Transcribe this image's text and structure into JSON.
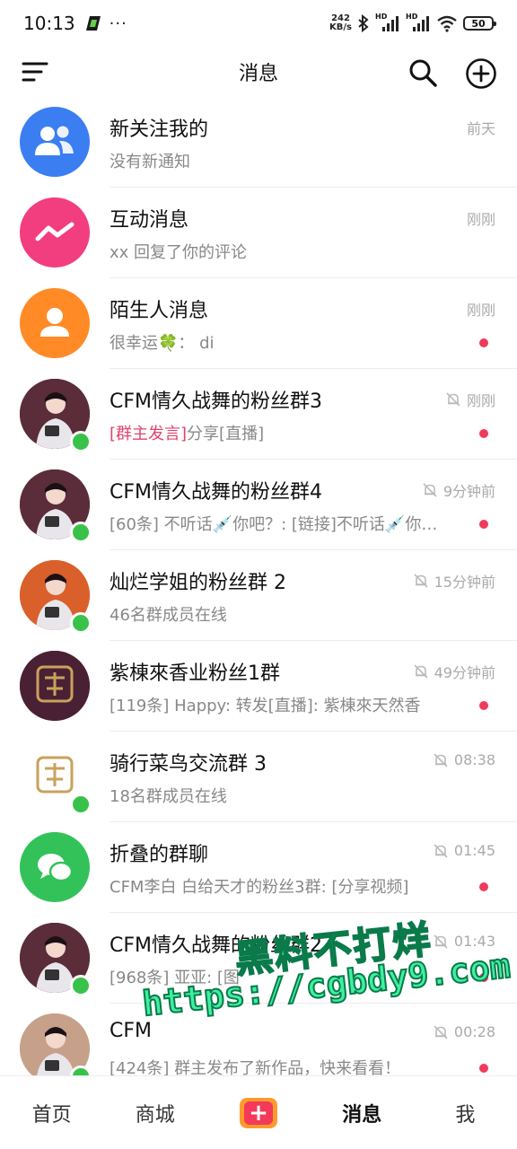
{
  "status_bar": {
    "time": "10:13",
    "net_speed_value": "242",
    "net_speed_unit": "KB/s",
    "hd1": "HD",
    "hd2": "HD",
    "battery": "50",
    "more": "···"
  },
  "header": {
    "title": "消息",
    "icons": [
      "menu-icon",
      "search-icon",
      "add-icon"
    ]
  },
  "conversations": [
    {
      "name": "新关注我的",
      "preview_tag": "",
      "preview": "没有新通知",
      "time": "前天",
      "muted": false,
      "unread": false,
      "online": false,
      "avatar": "followers-icon",
      "avatar_color": "#3a7ef2"
    },
    {
      "name": "互动消息",
      "preview_tag": "",
      "preview": "xx 回复了你的评论",
      "time": "刚刚",
      "muted": false,
      "unread": false,
      "online": false,
      "avatar": "interaction-icon",
      "avatar_color": "#f23d7e"
    },
    {
      "name": "陌生人消息",
      "preview_tag": "",
      "preview": "很幸运🍀： di",
      "time": "刚刚",
      "muted": false,
      "unread": true,
      "online": false,
      "avatar": "stranger-icon",
      "avatar_color": "#ff8a26"
    },
    {
      "name": "CFM情久战舞的粉丝群3",
      "preview_tag": "[群主发言]",
      "preview": "分享[直播]",
      "time": "刚刚",
      "muted": true,
      "unread": true,
      "online": true,
      "avatar": "group-photo",
      "avatar_color": "#5b2c3a"
    },
    {
      "name": "CFM情久战舞的粉丝群4",
      "preview_tag": "",
      "preview": "[60条] 不听话💉你吧？: [链接]不听话💉你…",
      "time": "9分钟前",
      "muted": true,
      "unread": true,
      "online": true,
      "avatar": "group-photo",
      "avatar_color": "#5b2c3a"
    },
    {
      "name": "灿烂学姐的粉丝群 2",
      "preview_tag": "",
      "preview": "46名群成员在线",
      "time": "15分钟前",
      "muted": true,
      "unread": false,
      "online": true,
      "avatar": "group-photo",
      "avatar_color": "#d9602a"
    },
    {
      "name": "紫棟來香业粉丝1群",
      "preview_tag": "",
      "preview": "[119条] Happy: 转发[直播]: 紫棟來天然香",
      "time": "49分钟前",
      "muted": true,
      "unread": true,
      "online": false,
      "avatar": "group-logo",
      "avatar_color": "#4a2035"
    },
    {
      "name": "骑行菜鸟交流群 3",
      "preview_tag": "",
      "preview": "18名群成员在线",
      "time": "08:38",
      "muted": true,
      "unread": false,
      "online": true,
      "avatar": "group-logo",
      "avatar_color": "#ffffff"
    },
    {
      "name": "折叠的群聊",
      "preview_tag": "",
      "preview": "CFM李白 白给天才的粉丝3群: [分享视频]",
      "time": "01:45",
      "muted": true,
      "unread": true,
      "online": false,
      "avatar": "folded-chat-icon",
      "avatar_color": "#33c25a"
    },
    {
      "name": "CFM情久战舞的粉丝群2",
      "preview_tag": "",
      "preview": "[968条] 亚亚: [图",
      "time": "01:43",
      "muted": true,
      "unread": true,
      "online": true,
      "avatar": "group-photo",
      "avatar_color": "#5b2c3a"
    },
    {
      "name": "CFM",
      "preview_tag": "",
      "preview": "[424条] 群主发布了新作品，快来看看！",
      "time": "00:28",
      "muted": true,
      "unread": true,
      "online": true,
      "avatar": "group-photo",
      "avatar_color": "#c7a08a"
    }
  ],
  "bottom_nav": [
    {
      "label": "首页",
      "active": false
    },
    {
      "label": "商城",
      "active": false
    },
    {
      "label": "+",
      "active": false
    },
    {
      "label": "消息",
      "active": true
    },
    {
      "label": "我",
      "active": false
    }
  ],
  "watermark": {
    "line1": "黑料不打烊",
    "line2": "https://cgbdy9.com"
  },
  "colors": {
    "unread": "#ef3b5a",
    "online": "#39c24a",
    "tag": "#e0436b"
  }
}
